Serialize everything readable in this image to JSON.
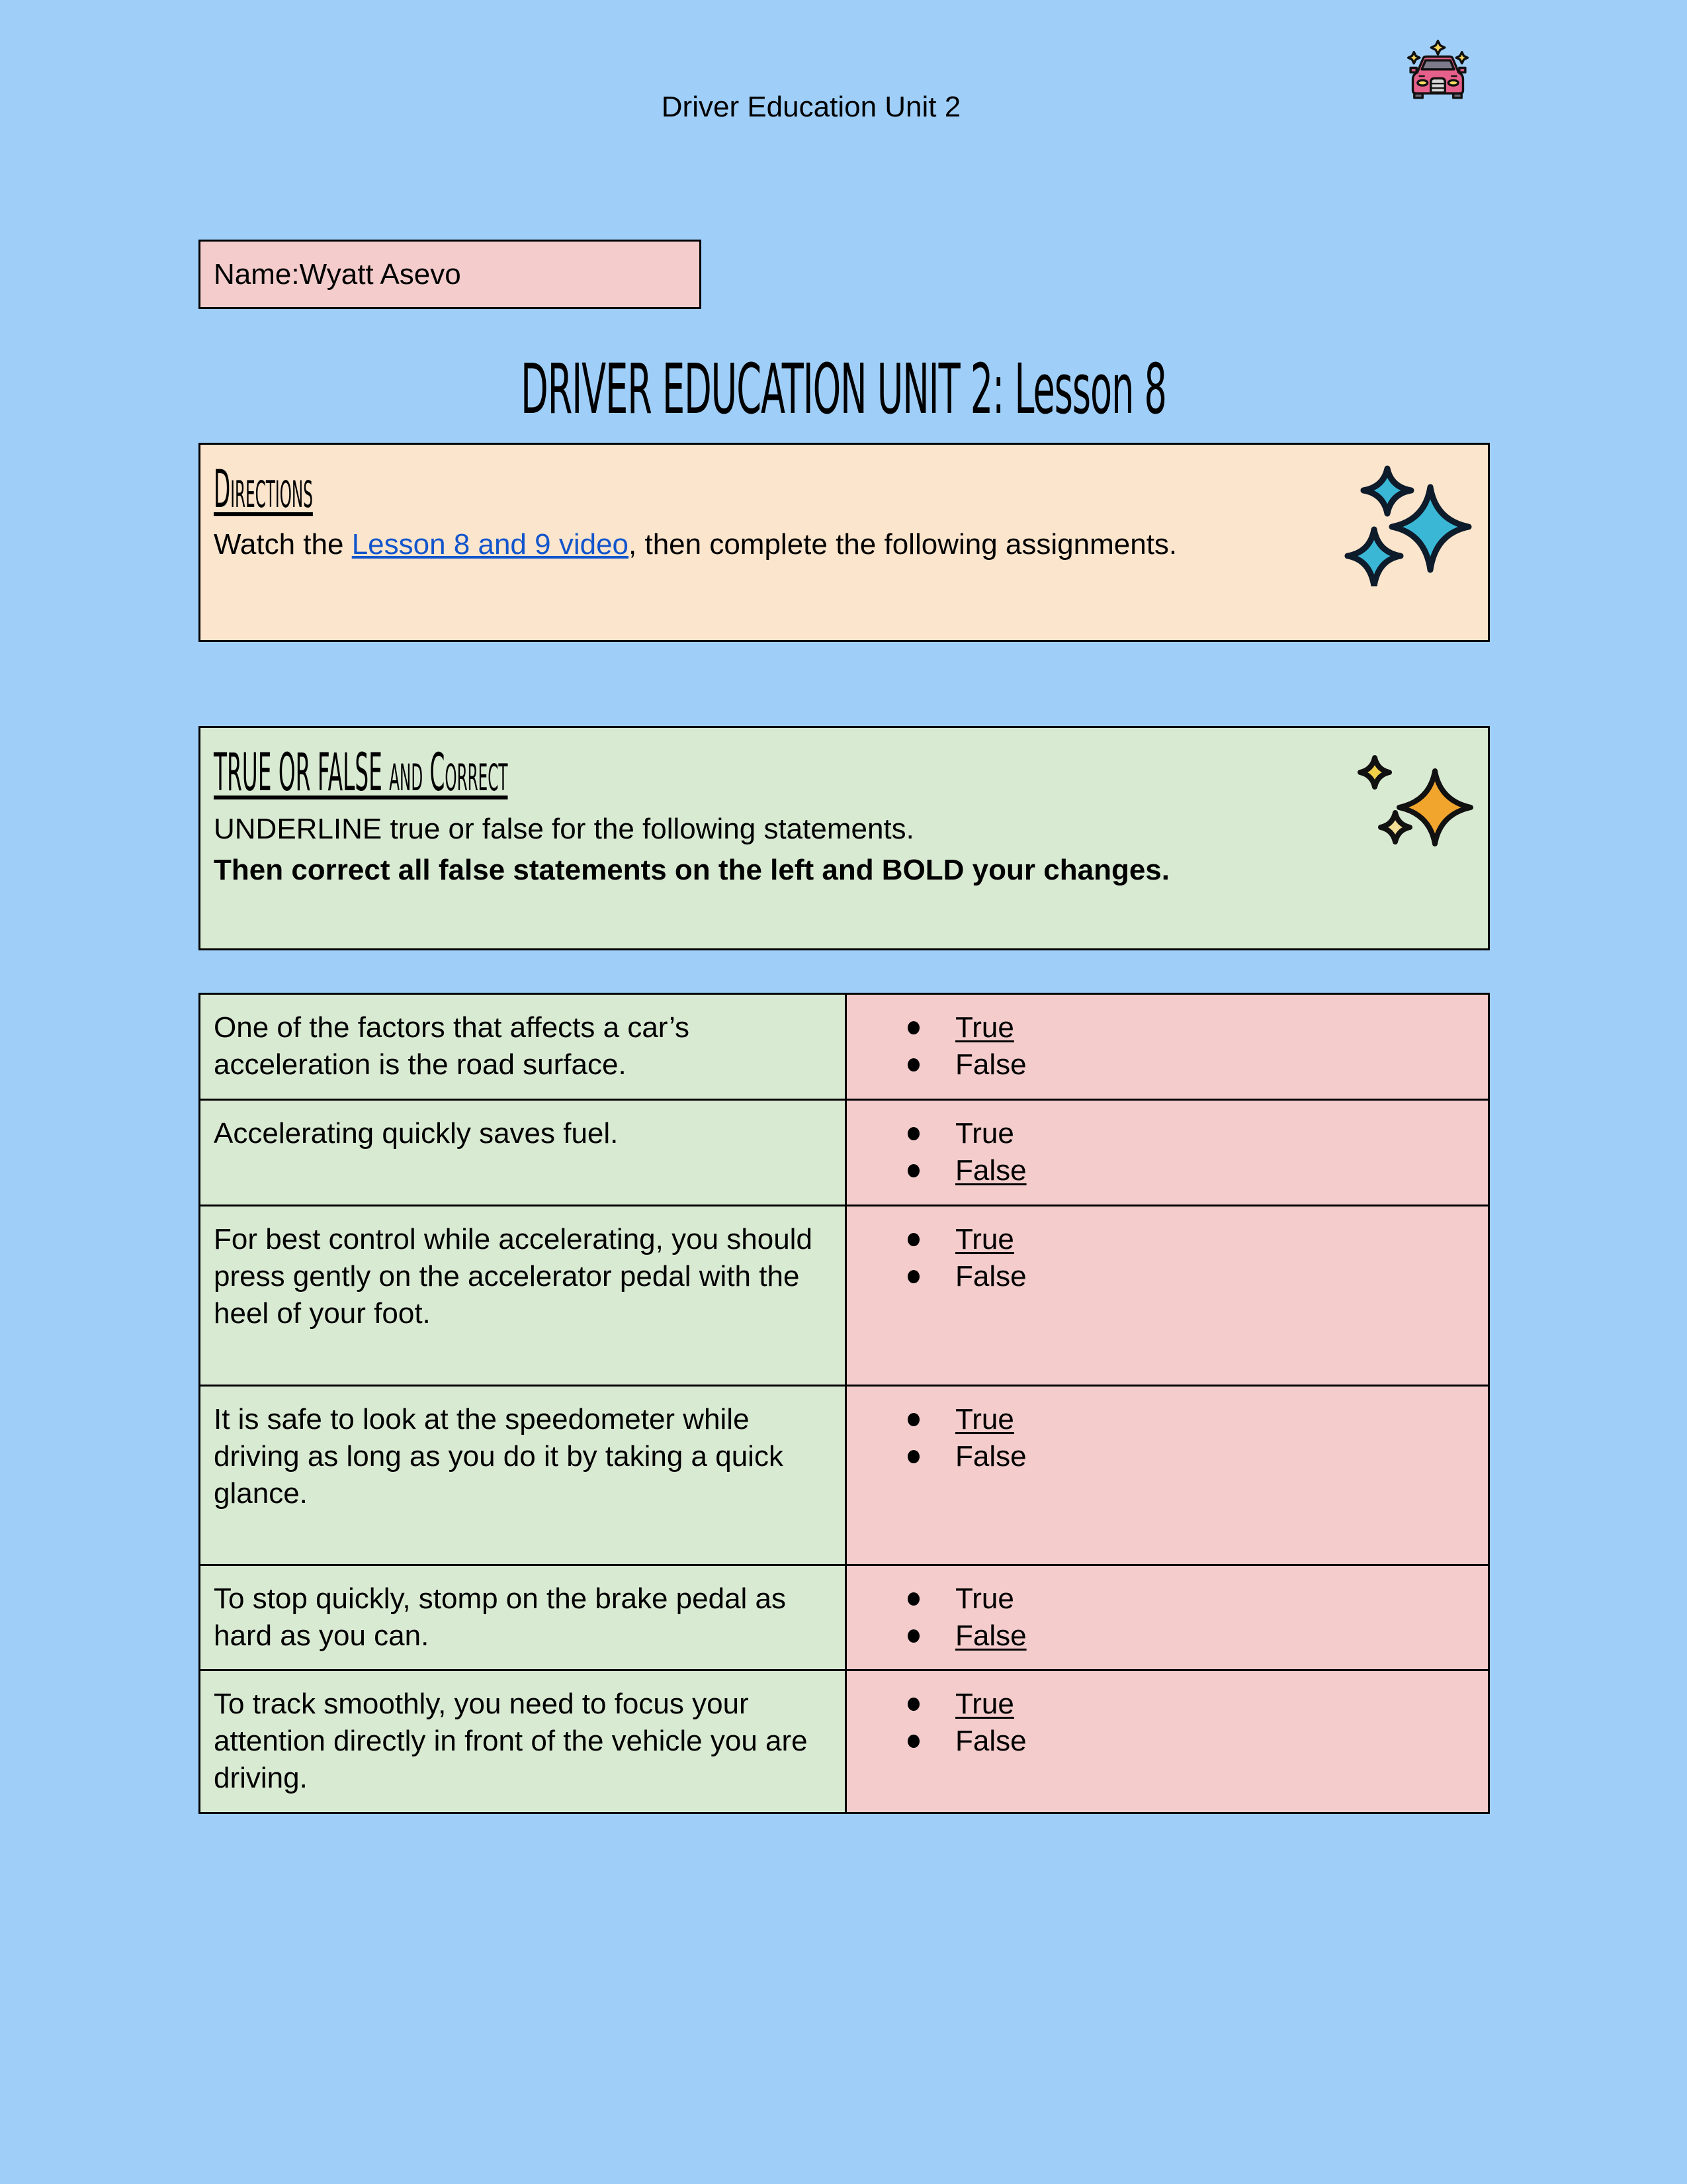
{
  "header": {
    "title": "Driver Education Unit 2",
    "icon": "car-sparkle-icon"
  },
  "name_field": {
    "label": "Name:",
    "value": "Wyatt Asevo"
  },
  "title": "DRIVER EDUCATION UNIT 2: Lesson 8",
  "directions": {
    "heading": "Directions",
    "text_before": "Watch the ",
    "link_text": "Lesson 8 and 9 video",
    "text_after": ", then complete the following assignments.",
    "icon": "blue-sparkles-icon"
  },
  "true_false": {
    "heading": "TRUE OR FALSE and Correct",
    "instruction": "UNDERLINE true or false for the following statements.",
    "instruction_bold": "Then correct all false statements on the left and BOLD your changes.",
    "icon": "gold-sparkles-icon"
  },
  "colors": {
    "page_background": "#9fcff9",
    "name_box": "#f4cccc",
    "directions_box": "#fce5cd",
    "true_false_box": "#d9ead3",
    "answer_cell": "#f4cccc",
    "link": "#1155cc"
  },
  "questions": [
    {
      "statement": "One of the factors that affects a car’s acceleration is the road surface.",
      "options": [
        {
          "label": "True",
          "selected": true
        },
        {
          "label": "False",
          "selected": false
        }
      ]
    },
    {
      "statement": "Accelerating quickly saves fuel.",
      "options": [
        {
          "label": "True",
          "selected": false
        },
        {
          "label": "False",
          "selected": true
        }
      ]
    },
    {
      "statement": "For best control while accelerating, you should press gently on the accelerator pedal with the heel of your foot.",
      "options": [
        {
          "label": "True",
          "selected": true
        },
        {
          "label": "False",
          "selected": false
        }
      ]
    },
    {
      "statement": "It is safe to look at the speedometer while driving as long as you do it by taking a quick glance.",
      "options": [
        {
          "label": "True",
          "selected": true
        },
        {
          "label": "False",
          "selected": false
        }
      ]
    },
    {
      "statement": "To stop quickly, stomp on the brake pedal as hard as you can.",
      "options": [
        {
          "label": "True",
          "selected": false
        },
        {
          "label": "False",
          "selected": true
        }
      ]
    },
    {
      "statement": "To track smoothly, you need to focus your attention directly in front of the vehicle you are driving.",
      "options": [
        {
          "label": "True",
          "selected": true
        },
        {
          "label": "False",
          "selected": false
        }
      ]
    }
  ]
}
